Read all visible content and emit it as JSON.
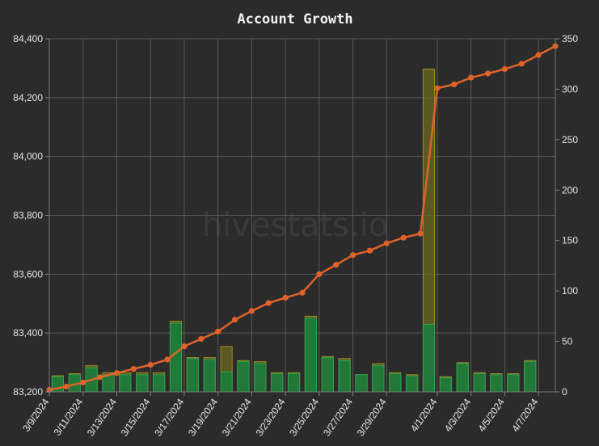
{
  "chart_data": {
    "type": "bar+line",
    "title": "Account Growth",
    "watermark": "hivestats.io",
    "x": [
      "3/9/2024",
      "3/10/2024",
      "3/11/2024",
      "3/12/2024",
      "3/13/2024",
      "3/14/2024",
      "3/15/2024",
      "3/16/2024",
      "3/17/2024",
      "3/18/2024",
      "3/19/2024",
      "3/20/2024",
      "3/21/2024",
      "3/22/2024",
      "3/23/2024",
      "3/24/2024",
      "3/25/2024",
      "3/26/2024",
      "3/27/2024",
      "3/28/2024",
      "3/29/2024",
      "3/30/2024",
      "3/31/2024",
      "4/1/2024",
      "4/2/2024",
      "4/3/2024",
      "4/4/2024",
      "4/5/2024",
      "4/6/2024",
      "4/7/2024",
      "4/8/2024"
    ],
    "x_tick_labels": [
      "3/9/2024",
      "3/11/2024",
      "3/13/2024",
      "3/15/2024",
      "3/17/2024",
      "3/19/2024",
      "3/21/2024",
      "3/23/2024",
      "3/25/2024",
      "3/27/2024",
      "3/29/2024",
      "4/1/2024",
      "4/3/2024",
      "4/5/2024",
      "4/7/2024"
    ],
    "y_left": {
      "ylim": [
        83200,
        84400
      ],
      "ticks": [
        "83,200",
        "83,400",
        "83,600",
        "83,800",
        "84,000",
        "84,200",
        "84,400"
      ]
    },
    "y_right": {
      "ylim": [
        0,
        350
      ],
      "ticks": [
        "0",
        "50",
        "100",
        "150",
        "200",
        "250",
        "300",
        "350"
      ]
    },
    "grid": true,
    "series": [
      {
        "axis": "left",
        "kind": "line",
        "color": "#e0622b",
        "values": [
          83207,
          83218,
          83232,
          83250,
          83264,
          83278,
          83292,
          83310,
          83355,
          83380,
          83405,
          83445,
          83475,
          83502,
          83520,
          83537,
          83600,
          83632,
          83665,
          83680,
          83705,
          83724,
          83738,
          84232,
          84245,
          84268,
          84282,
          84297,
          84315,
          84345,
          84375
        ]
      },
      {
        "axis": "right",
        "kind": "bar",
        "color": "#1f7a3a",
        "values": [
          15,
          17,
          24,
          17,
          17,
          17,
          17,
          68,
          33,
          32,
          20,
          30,
          28,
          18,
          18,
          73,
          34,
          31,
          17,
          26,
          18,
          16,
          67,
          14,
          28,
          18,
          17,
          17,
          30,
          0,
          0
        ]
      },
      {
        "axis": "right",
        "kind": "bar",
        "color": "#6b6a22",
        "values": [
          16,
          18,
          26,
          19,
          19,
          19,
          19,
          70,
          34,
          34,
          45,
          31,
          30,
          19,
          19,
          75,
          35,
          33,
          17,
          28,
          19,
          17,
          320,
          15,
          29,
          19,
          18,
          18,
          31,
          0,
          0
        ]
      }
    ]
  }
}
